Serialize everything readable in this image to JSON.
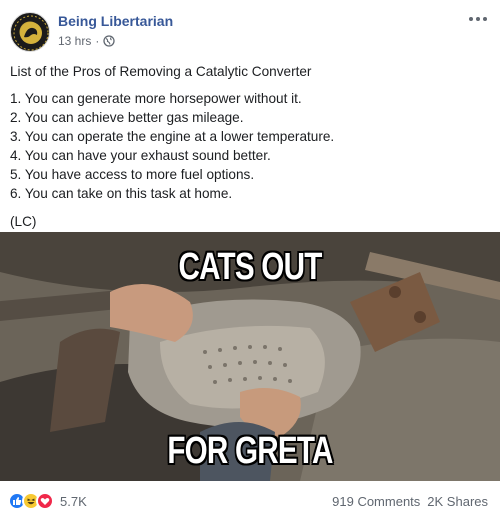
{
  "header": {
    "page_name": "Being Libertarian",
    "time": "13 hrs",
    "separator": "·",
    "privacy_icon": "globe-icon",
    "more_icon": "more-options-icon"
  },
  "post": {
    "title": "List of the Pros of Removing a Catalytic Converter",
    "items": [
      "1. You can generate more horsepower without it.",
      "2. You can achieve better gas mileage.",
      "3. You can operate the engine at a lower temperature.",
      "4. You can have your exhaust sound better.",
      "5. You have access to more fuel options.",
      "6. You can take on this task at home."
    ],
    "signature": "(LC)"
  },
  "image": {
    "caption_top": "CATS OUT",
    "caption_bottom": "FOR GRETA"
  },
  "footer": {
    "reaction_icons": [
      "like-icon",
      "haha-icon",
      "love-icon"
    ],
    "reaction_count": "5.7K",
    "comments": "919 Comments",
    "shares": "2K Shares"
  },
  "colors": {
    "page_name": "#385898",
    "secondary_text": "#616770",
    "like": "#2078f4",
    "haha": "#f7c933",
    "love": "#f0284a"
  }
}
